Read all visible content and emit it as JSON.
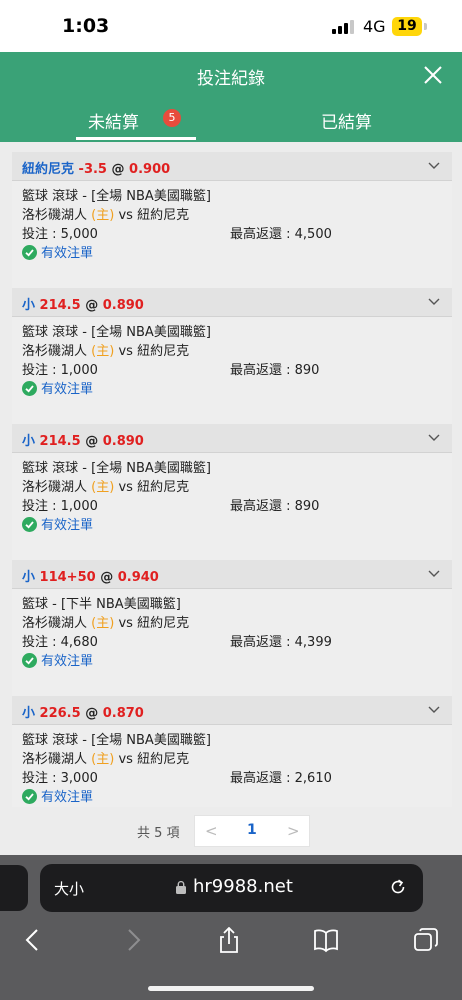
{
  "status_bar": {
    "time": "1:03",
    "network": "4G",
    "battery": "19"
  },
  "header": {
    "title": "投注紀錄"
  },
  "tabs": [
    {
      "label": "未結算",
      "badge": "5",
      "active": true
    },
    {
      "label": "已結算",
      "active": false
    }
  ],
  "bets": [
    {
      "selection": "紐約尼克",
      "handicap": "-3.5",
      "at": "@",
      "odds": "0.900",
      "market": "籃球 滾球 - [全場 NBA美國職籃]",
      "home_team": "洛杉磯湖人",
      "home_tag": "(主)",
      "vs": "vs",
      "away_team": "紐約尼克",
      "stake_label": "投注 : 5,000",
      "max_return_label": "最高返還 : 4,500",
      "status": "有效注單"
    },
    {
      "selection": "小",
      "handicap": "214.5",
      "at": "@",
      "odds": "0.890",
      "market": "籃球 滾球 - [全場 NBA美國職籃]",
      "home_team": "洛杉磯湖人",
      "home_tag": "(主)",
      "vs": "vs",
      "away_team": "紐約尼克",
      "stake_label": "投注 : 1,000",
      "max_return_label": "最高返還 : 890",
      "status": "有效注單"
    },
    {
      "selection": "小",
      "handicap": "214.5",
      "at": "@",
      "odds": "0.890",
      "market": "籃球 滾球 - [全場 NBA美國職籃]",
      "home_team": "洛杉磯湖人",
      "home_tag": "(主)",
      "vs": "vs",
      "away_team": "紐約尼克",
      "stake_label": "投注 : 1,000",
      "max_return_label": "最高返還 : 890",
      "status": "有效注單"
    },
    {
      "selection": "小",
      "handicap": "114+50",
      "at": "@",
      "odds": "0.940",
      "market": "籃球 - [下半 NBA美國職籃]",
      "home_team": "洛杉磯湖人",
      "home_tag": "(主)",
      "vs": "vs",
      "away_team": "紐約尼克",
      "stake_label": "投注 : 4,680",
      "max_return_label": "最高返還 : 4,399",
      "status": "有效注單"
    },
    {
      "selection": "小",
      "handicap": "226.5",
      "at": "@",
      "odds": "0.870",
      "market": "籃球 滾球 - [全場 NBA美國職籃]",
      "home_team": "洛杉磯湖人",
      "home_tag": "(主)",
      "vs": "vs",
      "away_team": "紐約尼克",
      "stake_label": "投注 : 3,000",
      "max_return_label": "最高返還 : 2,610",
      "status": "有效注單"
    }
  ],
  "pagination": {
    "total": "共 5 項",
    "prev": "<",
    "page": "1",
    "next": ">"
  },
  "browser": {
    "text_size": "大小",
    "url": "hr9988.net"
  },
  "colors": {
    "header_green": "#3aa277",
    "badge_red": "#e74c3c",
    "link_blue": "#1a64c8",
    "odds_red": "#e02020",
    "home_orange": "#f0a020"
  }
}
